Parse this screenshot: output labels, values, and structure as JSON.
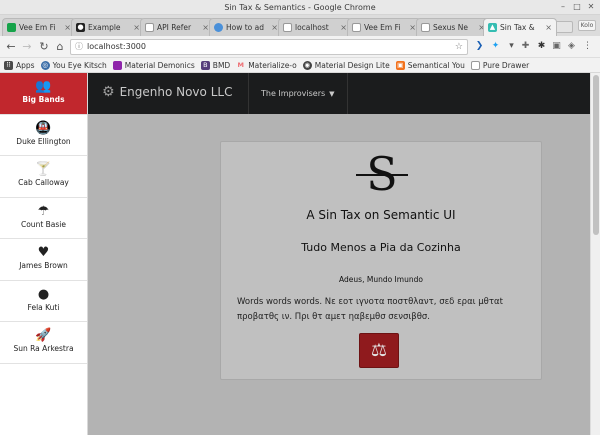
{
  "window": {
    "title": "Sin Tax & Semantics - Google Chrome"
  },
  "tabs": [
    {
      "label": "Vee Em Fi",
      "icon": "green-square-icon",
      "color": "#16a34a",
      "active": false
    },
    {
      "label": "Example",
      "icon": "github-icon",
      "color": "#222222",
      "active": false
    },
    {
      "label": "API Refer",
      "icon": "page-icon",
      "color": "#8a8a8a",
      "active": false
    },
    {
      "label": "How to ad",
      "icon": "loading-icon",
      "color": "#4a90d9",
      "active": false
    },
    {
      "label": "localhost",
      "icon": "page-icon",
      "color": "#8a8a8a",
      "active": false
    },
    {
      "label": "Vee Em Fi",
      "icon": "page-icon",
      "color": "#8a8a8a",
      "active": false
    },
    {
      "label": "Sexus Ne",
      "icon": "page-icon",
      "color": "#8a8a8a",
      "active": false
    },
    {
      "label": "Sin Tax &",
      "icon": "semantic-icon",
      "color": "#35bdb2",
      "active": true
    }
  ],
  "user_chip": "Kolo",
  "address": {
    "url": "localhost:3000"
  },
  "bookmarks": [
    {
      "label": "Apps",
      "icon": "apps-grid-icon",
      "color": "#4a4a4a"
    },
    {
      "label": "You Eye Kitsch",
      "icon": "ux-icon",
      "color": "#3b6ea8"
    },
    {
      "label": "Material Demonics",
      "icon": "material-icon",
      "color": "#8e24aa"
    },
    {
      "label": "BMD",
      "icon": "bootstrap-icon",
      "color": "#563d7c"
    },
    {
      "label": "Materialize-o",
      "icon": "materialize-icon",
      "color": "#ee6e73"
    },
    {
      "label": "Material Design Lite",
      "icon": "mdl-icon",
      "color": "#424242"
    },
    {
      "label": "Semantical You",
      "icon": "semantic-icon",
      "color": "#f2711c"
    },
    {
      "label": "Pure Drawer",
      "icon": "page-icon",
      "color": "#9a9a9a"
    }
  ],
  "sidebar": {
    "items": [
      {
        "label": "Big Bands",
        "icon": "users-icon",
        "active": true
      },
      {
        "label": "Duke Ellington",
        "icon": "subway-icon",
        "active": false
      },
      {
        "label": "Cab Calloway",
        "icon": "cocktail-icon",
        "active": false
      },
      {
        "label": "Count Basie",
        "icon": "umbrella-icon",
        "active": false
      },
      {
        "label": "James Brown",
        "icon": "heartbeat-icon",
        "active": false
      },
      {
        "label": "Fela Kuti",
        "icon": "bomb-icon",
        "active": false
      },
      {
        "label": "Sun Ra Arkestra",
        "icon": "rocket-icon",
        "active": false
      }
    ]
  },
  "topnav": {
    "brand": "Engenho Novo LLC",
    "dropdown": "The Improvisers"
  },
  "card": {
    "logo": "S",
    "title": "A Sin Tax on Semantic UI",
    "subtitle": "Tudo Menos a Pia da Cozinha",
    "small": "Adeus, Mundo Imundo",
    "body": "Words words words. Νε εοτ ιγνοτα ποστθλαντ, σεδ εραι μθταt προβατθς ιν. Πρι θτ αμετ ηαβεμθσ σενσιβθσ.",
    "button_icon": "balance-scale-icon"
  },
  "colors": {
    "accent": "#c1272d",
    "navbar": "#1b1c1d"
  }
}
